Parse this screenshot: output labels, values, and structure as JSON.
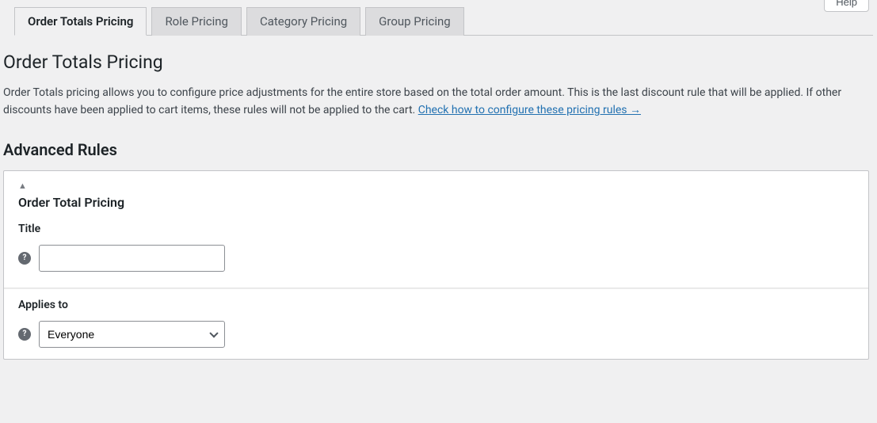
{
  "help_button": "Help",
  "tabs": {
    "order_totals": "Order Totals Pricing",
    "role": "Role Pricing",
    "category": "Category Pricing",
    "group": "Group Pricing"
  },
  "page": {
    "title": "Order Totals Pricing",
    "description_part1": "Order Totals pricing allows you to configure price adjustments for the entire store based on the total order amount. This is the last discount rule that will be applied. If other discounts have been applied to cart items, these rules will not be applied to the cart. ",
    "description_link": "Check how to configure these pricing rules →"
  },
  "section": {
    "title": "Advanced Rules"
  },
  "panel": {
    "title": "Order Total Pricing",
    "title_field": {
      "label": "Title",
      "value": ""
    },
    "applies_to": {
      "label": "Applies to",
      "selected": "Everyone",
      "options": [
        "Everyone"
      ]
    }
  }
}
